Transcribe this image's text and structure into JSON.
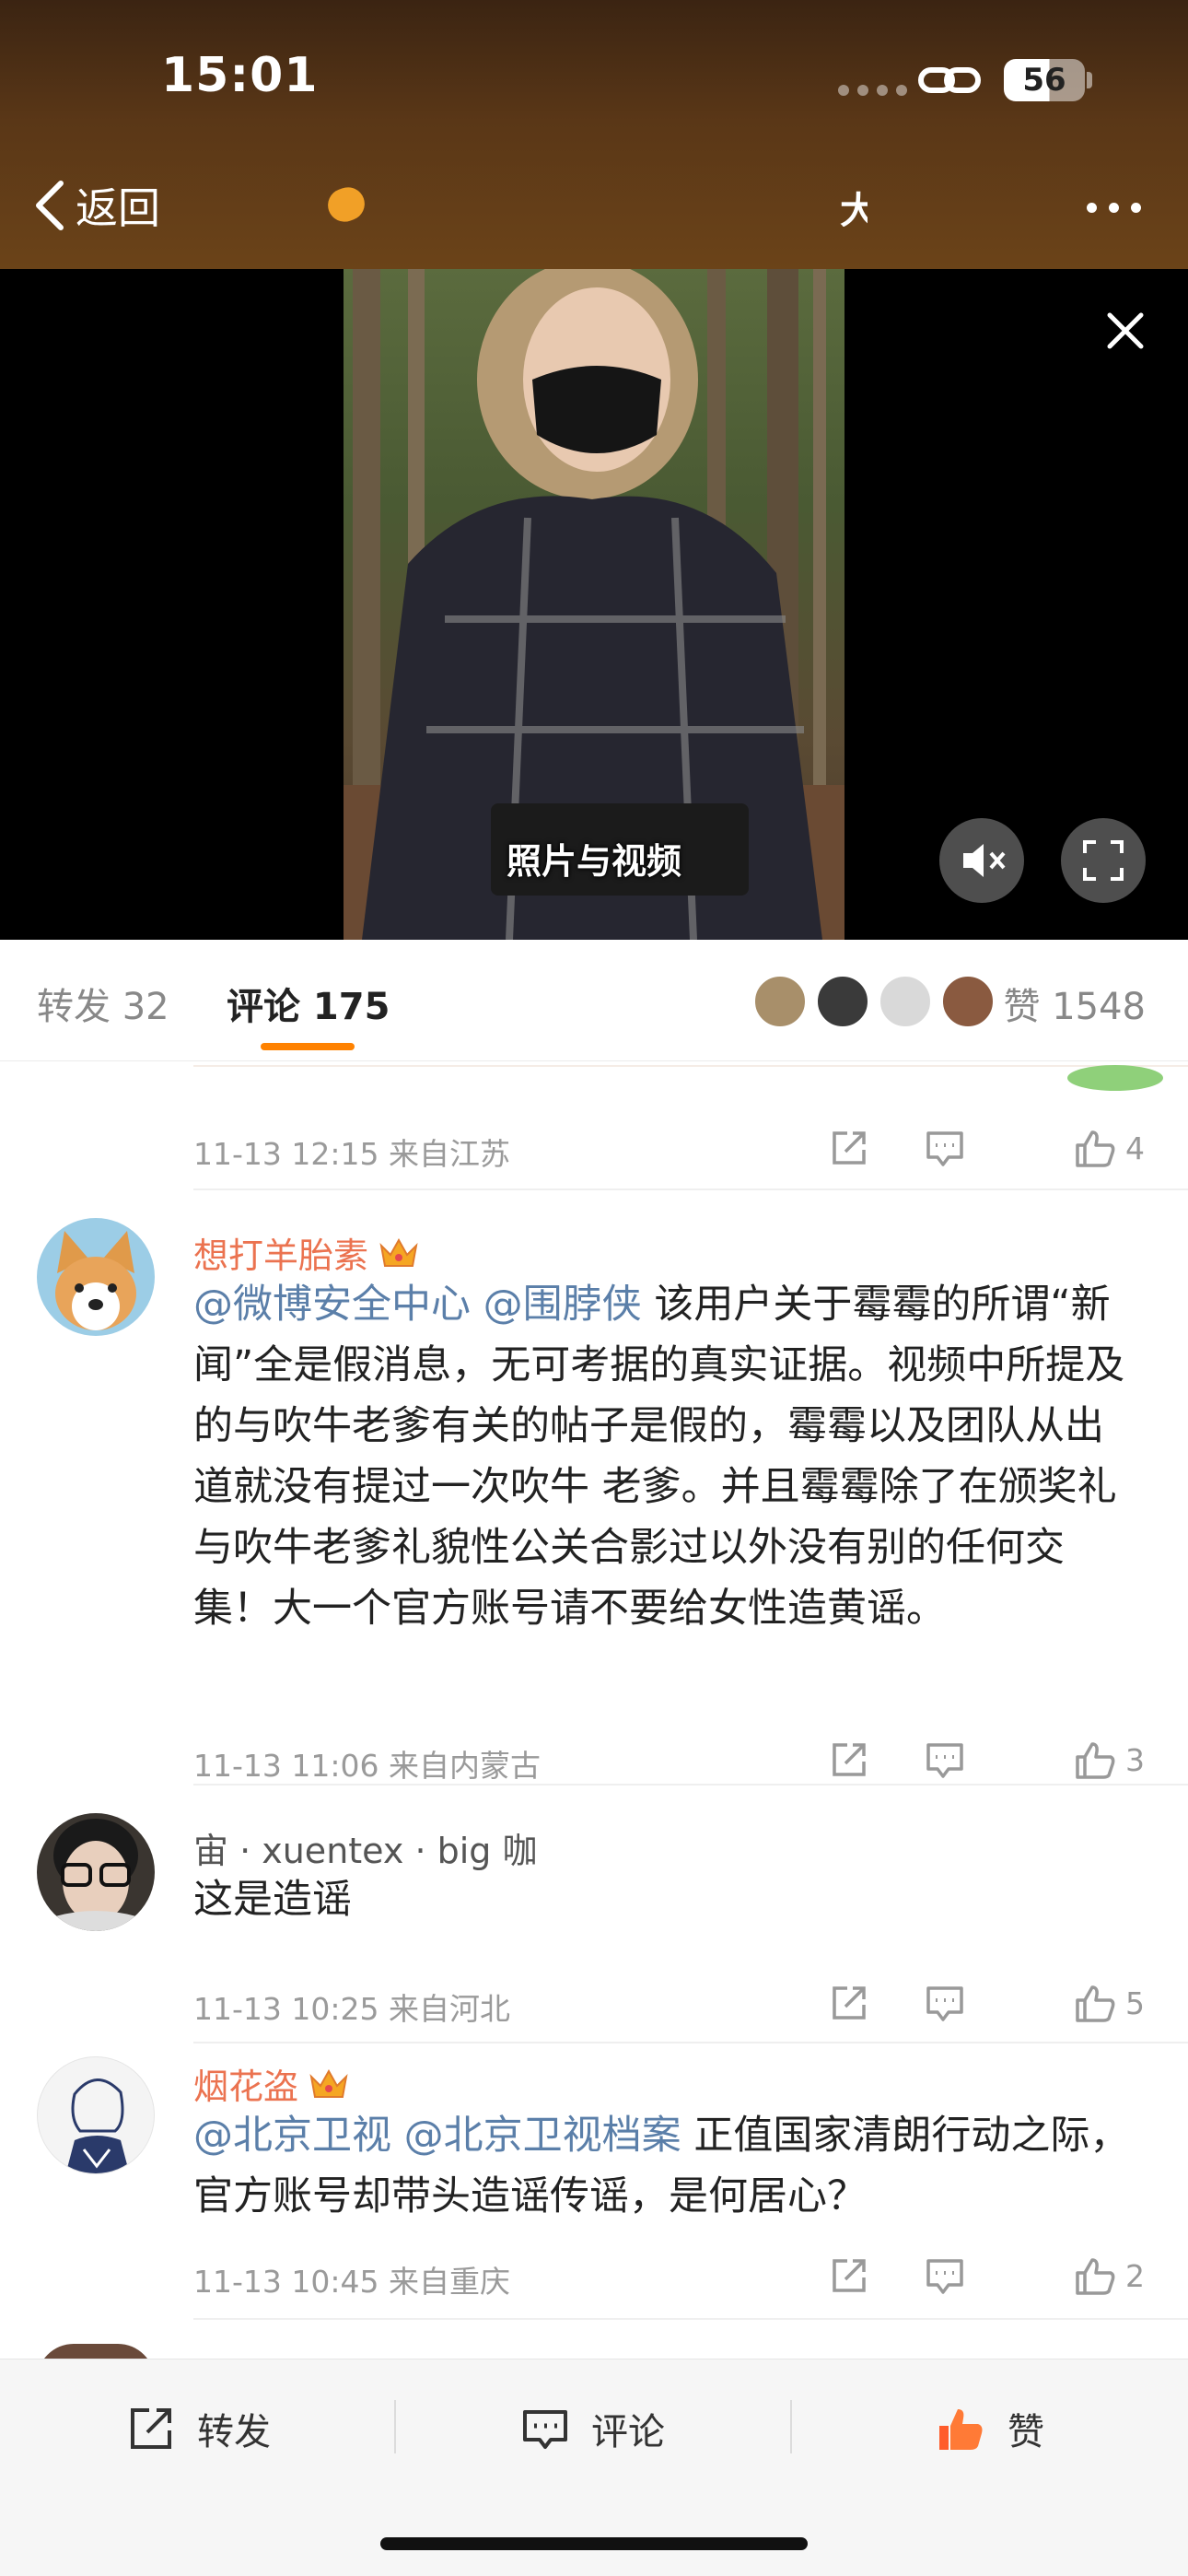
{
  "status_bar": {
    "time": "15:01",
    "battery": "56"
  },
  "nav": {
    "back_label": "返回",
    "middle_char": "大"
  },
  "video": {
    "caption": "照片与视频"
  },
  "tabs": {
    "repost": "转发 32",
    "comments": "评论 175",
    "likes": "赞 1548"
  },
  "comments": [
    {
      "meta": "11-13 12:15 来自江苏",
      "like_count": "4"
    },
    {
      "username": "想打羊胎素",
      "mentions": [
        "@微博安全中心",
        "@围脖侠"
      ],
      "text": "该用户关于霉霉的所谓“新闻”全是假消息，无可考据的真实证据。视频中所提及的与吹牛老爹有关的帖子是假的，霉霉以及团队从出道就没有提过一次吹牛 老爹。并且霉霉除了在颁奖礼与吹牛老爹礼貌性公关合影过以外没有别的任何交集！大一个官方账号请不要给女性造黄谣。",
      "meta": "11-13 11:06 来自内蒙古",
      "like_count": "3"
    },
    {
      "username": "宙 · xuentex · big 咖",
      "text": "这是造谣",
      "meta": "11-13 10:25 来自河北",
      "like_count": "5"
    },
    {
      "username": "烟花盗",
      "mentions": [
        "@北京卫视",
        "@北京卫视档案"
      ],
      "text": "正值国家清朗行动之际，官方账号却带头造谣传谣，是何居心？",
      "meta": "11-13 10:45 来自重庆",
      "like_count": "2"
    }
  ],
  "bottom_bar": {
    "repost": "转发",
    "comment": "评论",
    "like": "赞"
  },
  "colors": {
    "accent": "#ff8200",
    "vip_name": "#eb7350",
    "mention": "#5b7fa9",
    "like_active": "#ff5c2b"
  }
}
